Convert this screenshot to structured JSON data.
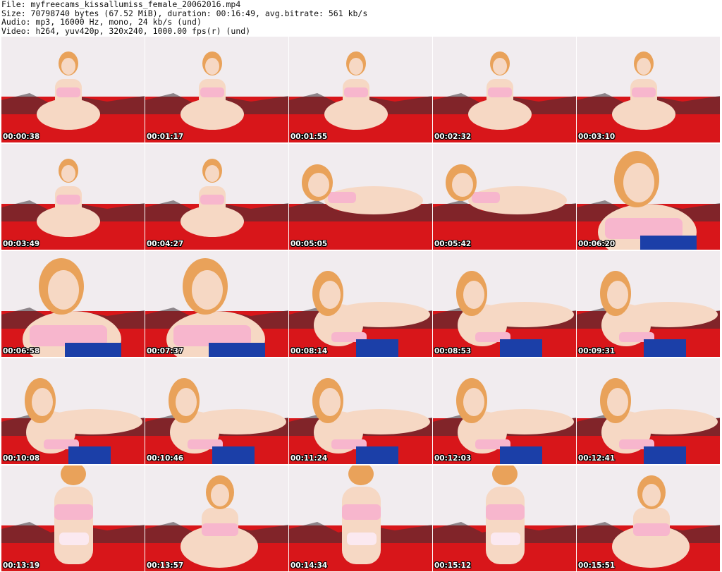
{
  "header": {
    "line1": "File: myfreecams_kissallumiss_female_20062016.mp4",
    "line2": "Size: 70798740 bytes (67.52 MiB), duration: 00:16:49, avg.bitrate: 561 kb/s",
    "line3": "Audio: mp3, 16000 Hz, mono, 24 kb/s (und)",
    "line4": "Video: h264, yuv420p, 320x240, 1000.00 fps(r) (und)"
  },
  "thumbnails": [
    {
      "timestamp": "00:00:38",
      "scene": "sitting"
    },
    {
      "timestamp": "00:01:17",
      "scene": "sitting"
    },
    {
      "timestamp": "00:01:55",
      "scene": "sitting"
    },
    {
      "timestamp": "00:02:32",
      "scene": "sitting"
    },
    {
      "timestamp": "00:03:10",
      "scene": "sitting"
    },
    {
      "timestamp": "00:03:49",
      "scene": "sitting"
    },
    {
      "timestamp": "00:04:27",
      "scene": "sitting"
    },
    {
      "timestamp": "00:05:05",
      "scene": "lying"
    },
    {
      "timestamp": "00:05:42",
      "scene": "lying"
    },
    {
      "timestamp": "00:06:20",
      "scene": "closeup"
    },
    {
      "timestamp": "00:06:58",
      "scene": "closeup"
    },
    {
      "timestamp": "00:07:37",
      "scene": "closeup"
    },
    {
      "timestamp": "00:08:14",
      "scene": "reclining"
    },
    {
      "timestamp": "00:08:53",
      "scene": "reclining"
    },
    {
      "timestamp": "00:09:31",
      "scene": "reclining"
    },
    {
      "timestamp": "00:10:08",
      "scene": "reclining"
    },
    {
      "timestamp": "00:10:46",
      "scene": "reclining"
    },
    {
      "timestamp": "00:11:24",
      "scene": "reclining"
    },
    {
      "timestamp": "00:12:03",
      "scene": "reclining"
    },
    {
      "timestamp": "00:12:41",
      "scene": "reclining"
    },
    {
      "timestamp": "00:13:19",
      "scene": "standing"
    },
    {
      "timestamp": "00:13:57",
      "scene": "kneeling"
    },
    {
      "timestamp": "00:14:34",
      "scene": "standing"
    },
    {
      "timestamp": "00:15:12",
      "scene": "standing"
    },
    {
      "timestamp": "00:15:51",
      "scene": "kneeling"
    }
  ],
  "colors": {
    "wall": "#f1ecef",
    "blanket": "#d8161a",
    "skin": "#f6d8c4",
    "hair": "#e9a25a",
    "top": "#f7b6cd",
    "blue": "#1b3fa8",
    "dark": "#3a3236"
  }
}
